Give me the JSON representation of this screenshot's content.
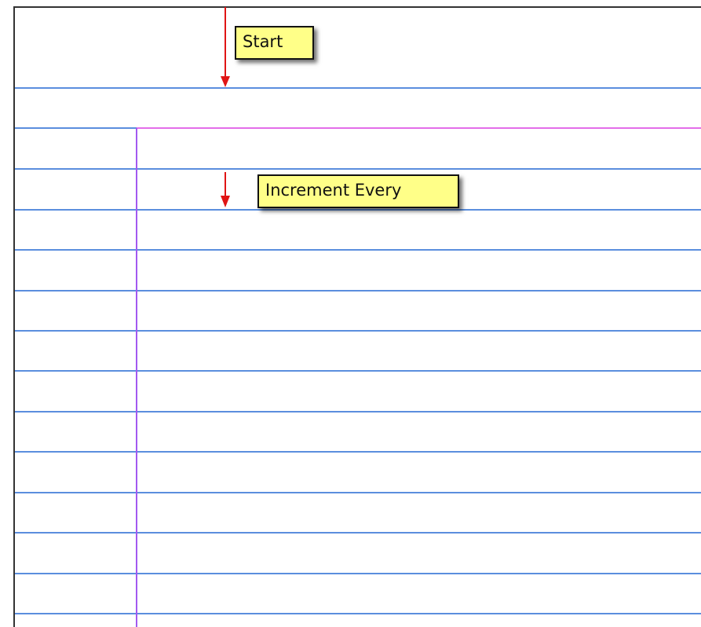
{
  "callouts": {
    "start_label": "Start",
    "increment_label": "Increment Every"
  },
  "colors": {
    "paper": "#ffffff",
    "paper_border": "#333333",
    "rule_line": "#5b8ede",
    "header_rule": "#e36ee9",
    "margin_line": "#a259f0",
    "arrow": "#e01515",
    "callout_fill": "#ffff88",
    "callout_border": "#111111"
  },
  "icons": {
    "start_arrow": "down-arrow-icon",
    "increment_arrow": "down-arrow-icon"
  }
}
